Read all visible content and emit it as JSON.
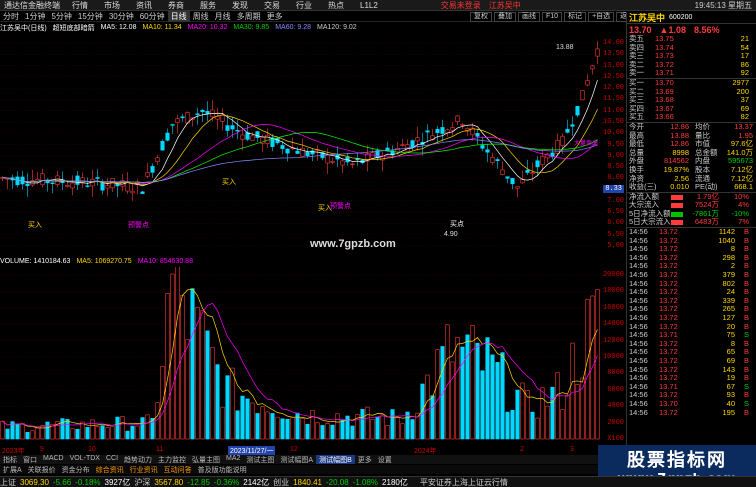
{
  "menubar": {
    "app": "通达信金融终端",
    "items": [
      "行情",
      "市场",
      "资讯",
      "券商",
      "服务",
      "发现",
      "交易",
      "行业",
      "热点",
      "L1L2"
    ],
    "login": "交易未登录",
    "stock": "江苏吴中",
    "clock": "19:45:13 星期五"
  },
  "periods": [
    "分时",
    "1分钟",
    "5分钟",
    "15分钟",
    "30分钟",
    "60分钟",
    "日线",
    "周线",
    "月线",
    "多周期",
    "更多"
  ],
  "active_period": "日线",
  "right_tools": [
    "复权",
    "叠加",
    "画线",
    "F10",
    "标记",
    "+自选",
    "返回"
  ],
  "chart_header": {
    "title": "江苏吴中(日线)",
    "indicator": "超短底部暗箭",
    "ma5": "MA5: 12.08",
    "ma10": "MA10: 11.34",
    "ma20": "MA20: 10.32",
    "ma30": "MA30: 9.85",
    "ma60": "MA60: 9.28",
    "ma120": "MA120: 9.02"
  },
  "chart_labels": {
    "high": "13.88",
    "low": "4.90",
    "buy1": "买入",
    "buy2": "买入",
    "buy3": "买点",
    "warn1": "预警点",
    "warn2": "预警点",
    "buy4": "买入",
    "sell": "大量卖出",
    "watermark": "www.7gpzb.com"
  },
  "vol_header": {
    "vol": "VOLUME: 1410184.63",
    "ma5": "MA5: 1069270.75",
    "ma10": "MA10: 854630.88"
  },
  "main_yaxis": [
    "14.00",
    "13.50",
    "13.00",
    "12.50",
    "12.00",
    "11.50",
    "11.00",
    "10.50",
    "10.00",
    "9.50",
    "9.00",
    "8.50",
    "8.00",
    "7.50",
    "7.00",
    "6.50",
    "6.00",
    "5.50",
    "5.00"
  ],
  "price_marker": "8.33",
  "vol_yaxis": [
    "20000",
    "18000",
    "16000",
    "14000",
    "12000",
    "10000",
    "8000",
    "6000",
    "4000",
    "2000",
    "X100"
  ],
  "dates": {
    "left": "2023年",
    "m1": "9",
    "m2": "10",
    "m3": "11",
    "selected": "2023/11/27/一",
    "m4": "12",
    "m5": "2024年",
    "m6": "2",
    "m7": "3"
  },
  "indicator_tabs": [
    "指标",
    "窗口",
    "MACD",
    "VOL-TDX",
    "CCI",
    "趋势动力",
    "主力监控",
    "弘量主图",
    "MA2",
    "测试主图",
    "测试幅图A",
    "测试幅图B",
    "更多",
    "设置"
  ],
  "sub_tabs": [
    "扩展A",
    "关联报价",
    "资金分布",
    "综合资讯",
    "行业资讯",
    "互动问答",
    "普及版功能说明"
  ],
  "sub_hl": [
    "综合资讯",
    "行业资讯",
    "互动问答"
  ],
  "quote": {
    "name": "江苏吴中",
    "code": "600200",
    "price": "13.70",
    "change": "▲1.08",
    "pct": "8.56%",
    "asks": [
      {
        "label": "卖五",
        "price": "13.75",
        "vol": "21"
      },
      {
        "label": "卖四",
        "price": "13.74",
        "vol": "54"
      },
      {
        "label": "卖三",
        "price": "13.73",
        "vol": "17"
      },
      {
        "label": "卖二",
        "price": "13.72",
        "vol": "86"
      },
      {
        "label": "卖一",
        "price": "13.71",
        "vol": "92"
      }
    ],
    "bids": [
      {
        "label": "买一",
        "price": "13.70",
        "vol": "2977"
      },
      {
        "label": "买二",
        "price": "13.69",
        "vol": "200"
      },
      {
        "label": "买三",
        "price": "13.68",
        "vol": "37"
      },
      {
        "label": "买四",
        "price": "13.67",
        "vol": "69"
      },
      {
        "label": "买五",
        "price": "13.66",
        "vol": "82"
      }
    ],
    "stats": [
      {
        "k1": "今开",
        "v1": "12.86",
        "c1": "red",
        "k2": "均价",
        "v2": "13.37",
        "c2": "red"
      },
      {
        "k1": "最高",
        "v1": "13.88",
        "c1": "red",
        "k2": "量比",
        "v2": "1.95",
        "c2": "red"
      },
      {
        "k1": "最低",
        "v1": "12.86",
        "c1": "red",
        "k2": "市值",
        "v2": "97.6亿",
        "c2": "yellow"
      },
      {
        "k1": "总量",
        "v1": "8998",
        "c1": "yellow",
        "k2": "总金额",
        "v2": "141.0万",
        "c2": "yellow"
      },
      {
        "k1": "外盘",
        "v1": "814562",
        "c1": "red",
        "k2": "内盘",
        "v2": "595673",
        "c2": "green"
      },
      {
        "k1": "换手",
        "v1": "19.87%",
        "c1": "yellow",
        "k2": "股本",
        "v2": "7.12亿",
        "c2": "yellow"
      },
      {
        "k1": "净资",
        "v1": "2.56",
        "c1": "yellow",
        "k2": "流通",
        "v2": "7.12亿",
        "c2": "yellow"
      },
      {
        "k1": "收益(三)",
        "v1": "0.010",
        "c1": "yellow",
        "k2": "PE(动)",
        "v2": "668.1",
        "c2": "yellow"
      }
    ],
    "flows": [
      {
        "k": "净流入额",
        "v": "1.79亿",
        "pct": "10%",
        "color": "#ff3c3c",
        "vc": "red"
      },
      {
        "k": "大宗流入",
        "v": "7524万",
        "pct": "4%",
        "color": "#ff3c3c",
        "vc": "red"
      },
      {
        "k": "5日净流入额",
        "v": "-7861万",
        "pct": "-10%",
        "color": "#00c000",
        "vc": "green"
      },
      {
        "k": "5日大宗流入",
        "v": "6483万",
        "pct": "7%",
        "color": "#ff3c3c",
        "vc": "red"
      }
    ],
    "ticks": [
      {
        "t": "14:56",
        "p": "13.72",
        "v": "1142",
        "bs": "B"
      },
      {
        "t": "14:56",
        "p": "13.72",
        "v": "1040",
        "bs": "B"
      },
      {
        "t": "14:56",
        "p": "13.72",
        "v": "8",
        "bs": "B"
      },
      {
        "t": "14:56",
        "p": "13.72",
        "v": "298",
        "bs": "B"
      },
      {
        "t": "14:56",
        "p": "13.72",
        "v": "2",
        "bs": "B"
      },
      {
        "t": "14:56",
        "p": "13.72",
        "v": "379",
        "bs": "B"
      },
      {
        "t": "14:56",
        "p": "13.72",
        "v": "802",
        "bs": "B"
      },
      {
        "t": "14:56",
        "p": "13.72",
        "v": "24",
        "bs": "B"
      },
      {
        "t": "14:56",
        "p": "13.72",
        "v": "339",
        "bs": "B"
      },
      {
        "t": "14:56",
        "p": "13.72",
        "v": "265",
        "bs": "B"
      },
      {
        "t": "14:56",
        "p": "13.72",
        "v": "127",
        "bs": "B"
      },
      {
        "t": "14:56",
        "p": "13.72",
        "v": "20",
        "bs": "B"
      },
      {
        "t": "14:56",
        "p": "13.71",
        "v": "75",
        "bs": "S"
      },
      {
        "t": "14:56",
        "p": "13.72",
        "v": "8",
        "bs": "B"
      },
      {
        "t": "14:56",
        "p": "13.72",
        "v": "65",
        "bs": "B"
      },
      {
        "t": "14:56",
        "p": "13.72",
        "v": "69",
        "bs": "B"
      },
      {
        "t": "14:56",
        "p": "13.72",
        "v": "143",
        "bs": "B"
      },
      {
        "t": "14:56",
        "p": "13.72",
        "v": "19",
        "bs": "B"
      },
      {
        "t": "14:56",
        "p": "13.71",
        "v": "67",
        "bs": "S"
      },
      {
        "t": "14:56",
        "p": "13.72",
        "v": "93",
        "bs": "B"
      },
      {
        "t": "14:56",
        "p": "13.70",
        "v": "40",
        "bs": "S"
      },
      {
        "t": "14:56",
        "p": "13.72",
        "v": "195",
        "bs": "B"
      }
    ],
    "foot": [
      "筹码",
      "分时"
    ]
  },
  "status": {
    "sh_label": "上证",
    "sh_val": "3069.30",
    "sh_chg": "-5.66",
    "sh_pct": "-0.18%",
    "sh_amt": "3927亿",
    "hs_label": "沪深",
    "hs_val": "3567.80",
    "hs_chg": "-12.85",
    "hs_pct": "-0.36%",
    "hs_amt": "2142亿",
    "cy_label": "创业",
    "cy_val": "1840.41",
    "cy_chg": "-20.08",
    "cy_pct": "-1.08%",
    "cy_amt": "2180亿",
    "right": "平安证券上海上证云行情"
  },
  "watermark": {
    "line1": "股票指标网",
    "line2": "www.7gpzb.com"
  },
  "colors": {
    "up": "#ff3c3c",
    "down": "#00d8ff",
    "ma5": "#ffffff",
    "ma10": "#ffd700",
    "ma20": "#ff00ff",
    "ma30": "#00ff00",
    "ma60": "#8888ff",
    "grid": "#5a0000"
  }
}
